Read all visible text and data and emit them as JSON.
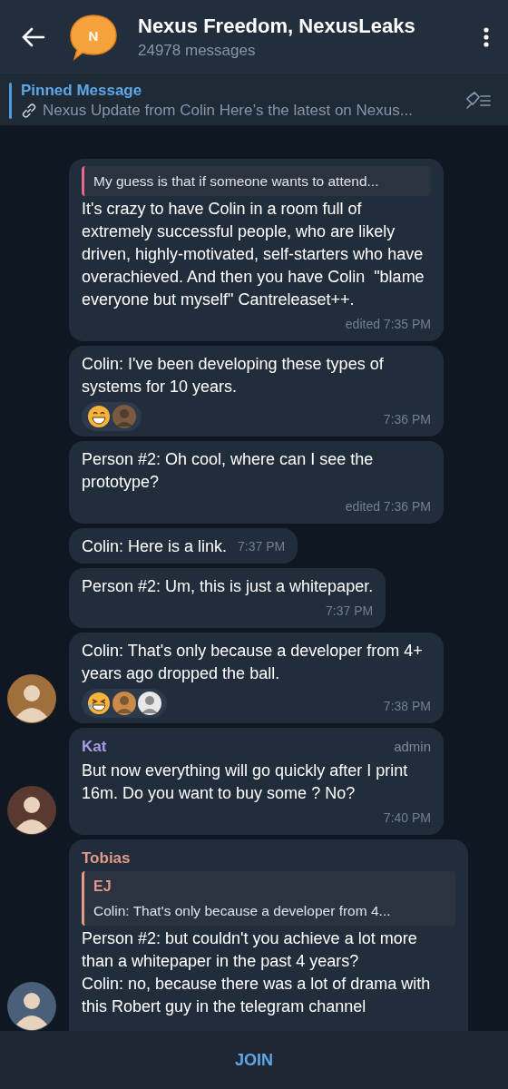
{
  "header": {
    "title": "Nexus Freedom, NexusLeaks",
    "subtitle": "24978 messages",
    "avatar_letter": "N"
  },
  "pinned": {
    "label": "Pinned Message",
    "text": "Nexus Update from Colin Here’s the latest on Nexus..."
  },
  "messages": [
    {
      "reply": {
        "text": "My guess is that if someone wants to attend..."
      },
      "text": "It's crazy to have Colin in a room full of extremely successful people, who are likely driven, highly-motivated, self-starters who have overachieved. And then you have Colin  \"blame everyone but myself\" Cantreleaset++.",
      "time": "edited 7:35 PM"
    },
    {
      "text": "Colin: I've been developing these types of systems for 10 years.",
      "time": "7:36 PM",
      "reactions": [
        {
          "kind": "grin"
        },
        {
          "kind": "avatar",
          "color": "#7a5a40"
        }
      ]
    },
    {
      "text": "Person #2: Oh cool, where can I see the prototype?",
      "time": "edited 7:36 PM"
    },
    {
      "text": "Colin: Here is a link.",
      "time": "7:37 PM"
    },
    {
      "text": "Person #2: Um, this is just a whitepaper.",
      "time": "7:37 PM"
    },
    {
      "text": "Colin: That's only because a developer from 4+ years ago dropped the ball.",
      "time": "7:38 PM",
      "reactions": [
        {
          "kind": "laugh"
        },
        {
          "kind": "avatar",
          "color": "#c98a4a"
        },
        {
          "kind": "avatar",
          "color": "#e8e8e8"
        }
      ],
      "avatar": {
        "color": "#a0703c"
      }
    },
    {
      "sender": {
        "name": "Kat",
        "color": "#a99be8"
      },
      "badge": "admin",
      "text": "But now everything will go quickly after I print 16m. Do you want to buy some ? No?",
      "time": "7:40 PM",
      "avatar": {
        "color": "#5a3a30"
      }
    },
    {
      "sender": {
        "name": "Tobias",
        "color": "#e39a86"
      },
      "reply": {
        "name": "EJ",
        "color": "#e39a86",
        "text": "Colin: That's only because a developer from 4..."
      },
      "text": "Person #2: but couldn't you achieve a lot more than a whitepaper in the past 4 years?\nColin: no, because there was a lot of drama with this Robert guy in the telegram channel",
      "avatar": {
        "color": "#4a5f78"
      }
    }
  ],
  "join_button": "JOIN"
}
